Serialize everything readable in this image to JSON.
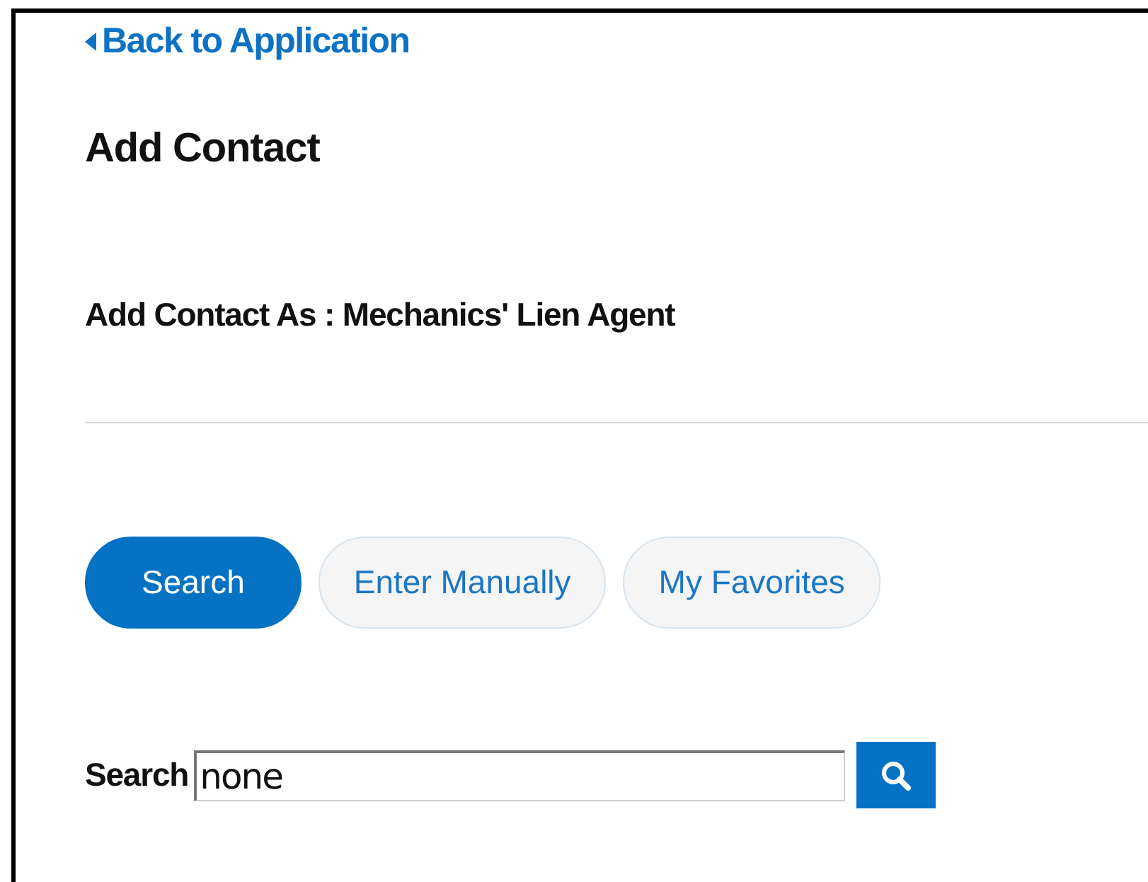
{
  "back_link": {
    "label": "Back to Application"
  },
  "heading": "Add Contact",
  "contact_type": {
    "label": "Add Contact As",
    "separator": ":",
    "value": "Mechanics' Lien Agent"
  },
  "tabs": [
    {
      "label": "Search",
      "selected": true
    },
    {
      "label": "Enter Manually",
      "selected": false
    },
    {
      "label": "My Favorites",
      "selected": false
    }
  ],
  "search": {
    "label": "Search",
    "value": "none"
  }
}
